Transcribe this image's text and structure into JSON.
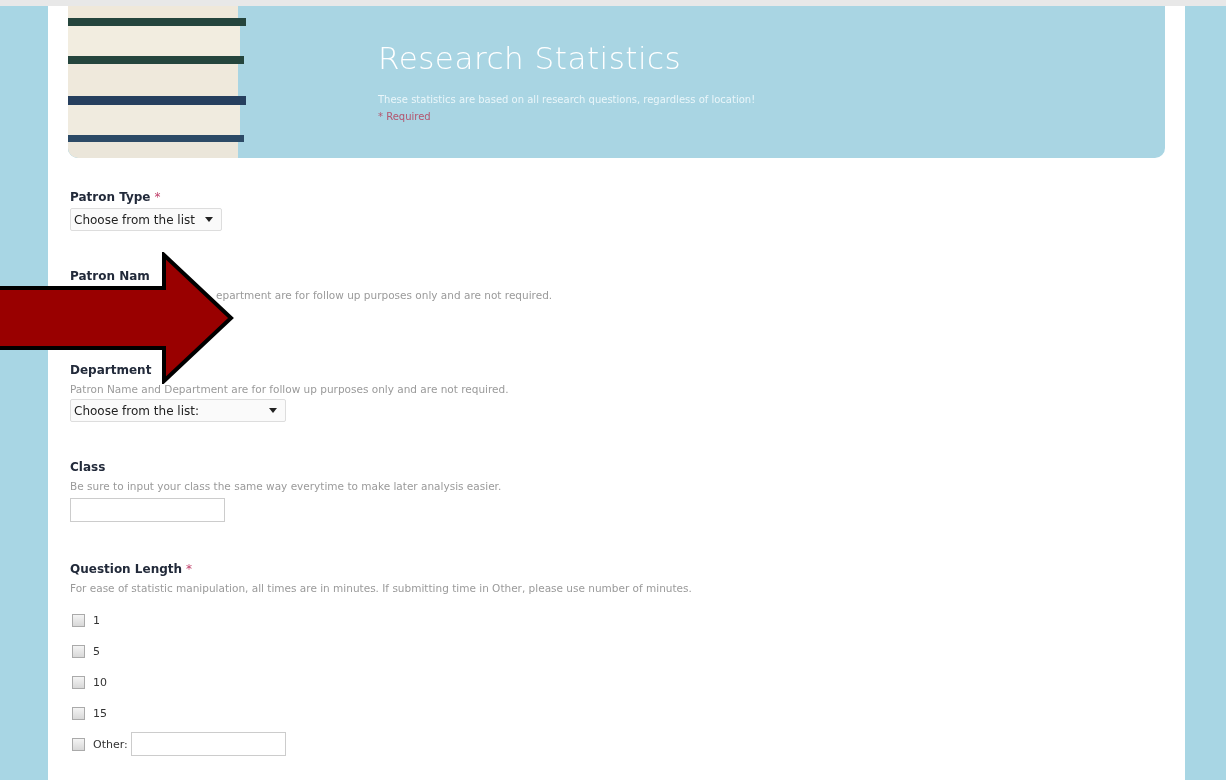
{
  "header": {
    "title": "Research Statistics",
    "description": "These statistics are based on all research questions, regardless of location!",
    "required_note": "* Required"
  },
  "questions": [
    {
      "kind": "select",
      "label": "Patron Type",
      "required_mark": "*",
      "value": "Choose from the list"
    },
    {
      "kind": "covered",
      "label": "Patron Nam",
      "help": "epartment are for follow up purposes only and are not required."
    },
    {
      "kind": "select",
      "label": "Department",
      "help": "Patron Name and Department are for follow up purposes only and are not required.",
      "value": "Choose from the list:"
    },
    {
      "kind": "text",
      "label": "Class",
      "help": "Be sure to input your class the same way everytime to make later analysis easier."
    },
    {
      "kind": "checkboxes",
      "label": "Question Length",
      "required_mark": "*",
      "help": "For ease of statistic manipulation, all times are in minutes. If submitting time in Other, please use number of minutes.",
      "options": [
        {
          "kind": "plain",
          "label": "1",
          "checked": false
        },
        {
          "kind": "plain",
          "label": "5",
          "checked": false
        },
        {
          "kind": "plain",
          "label": "10",
          "checked": false
        },
        {
          "kind": "plain",
          "label": "15",
          "checked": false
        },
        {
          "kind": "other",
          "label": "Other:",
          "checked": false
        }
      ]
    }
  ]
}
